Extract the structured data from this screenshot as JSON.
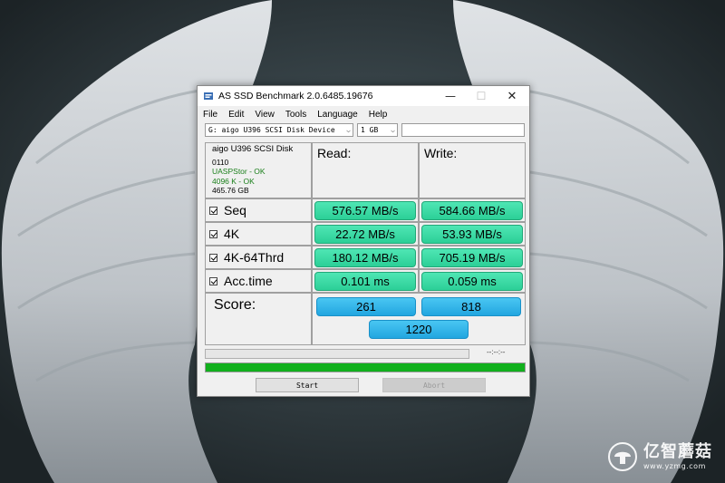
{
  "window": {
    "title": "AS SSD Benchmark 2.0.6485.19676",
    "controls": {
      "minimize": "—",
      "maximize": "☐",
      "close": "✕"
    }
  },
  "menu": [
    "File",
    "Edit",
    "View",
    "Tools",
    "Language",
    "Help"
  ],
  "selectors": {
    "drive": "G: aigo U396 SCSI Disk Device",
    "size": "1 GB",
    "extra": ""
  },
  "device_info": {
    "model": "aigo U396 SCSI Disk",
    "firmware": "0110",
    "driver_status": "UASPStor - OK",
    "alignment": "4096 K - OK",
    "capacity": "465.76 GB"
  },
  "headers": {
    "read": "Read:",
    "write": "Write:"
  },
  "tests": [
    {
      "label": "Seq",
      "checked": true,
      "read": "576.57 MB/s",
      "write": "584.66 MB/s"
    },
    {
      "label": "4K",
      "checked": true,
      "read": "22.72 MB/s",
      "write": "53.93 MB/s"
    },
    {
      "label": "4K-64Thrd",
      "checked": true,
      "read": "180.12 MB/s",
      "write": "705.19 MB/s"
    },
    {
      "label": "Acc.time",
      "checked": true,
      "read": "0.101 ms",
      "write": "0.059 ms"
    }
  ],
  "score": {
    "label": "Score:",
    "read": "261",
    "write": "818",
    "total": "1220"
  },
  "status": {
    "elapsed": "--:--:--",
    "progress": 1.0
  },
  "buttons": {
    "start": "Start",
    "abort": "Abort"
  },
  "watermark": {
    "brand": "亿智蘑菇",
    "url": "www.yzmg.com"
  },
  "colors": {
    "value_green": "#2ccf97",
    "score_blue": "#22a6e0",
    "progress_green": "#11b01d"
  }
}
